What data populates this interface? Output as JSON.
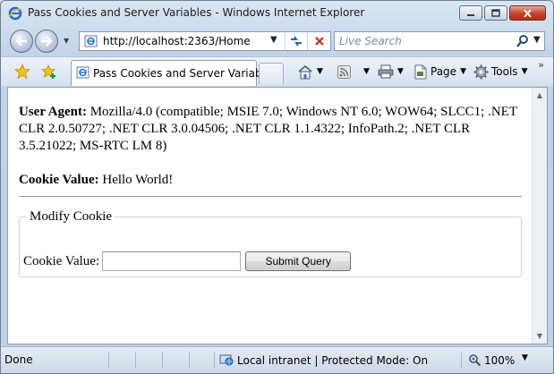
{
  "window": {
    "title": "Pass Cookies and Server Variables - Windows Internet Explorer"
  },
  "toolbar": {
    "address": "http://localhost:2363/Home",
    "search_placeholder": "Live Search"
  },
  "tab": {
    "label": "Pass Cookies and Server Variables"
  },
  "commands": {
    "page_label": "Page",
    "tools_label": "Tools",
    "more": "»"
  },
  "content": {
    "user_agent_label": "User Agent:",
    "user_agent_value": " Mozilla/4.0 (compatible; MSIE 7.0; Windows NT 6.0; WOW64; SLCC1; .NET CLR 2.0.50727; .NET CLR 3.0.04506; .NET CLR 1.1.4322; InfoPath.2; .NET CLR 3.5.21022; MS-RTC LM 8)",
    "cookie_label": "Cookie Value:",
    "cookie_value": " Hello World!",
    "fieldset_legend": "Modify Cookie",
    "input_label": "Cookie Value:",
    "input_value": "",
    "submit_label": "Submit Query"
  },
  "status": {
    "text": "Done",
    "zone": "Local intranet | Protected Mode: On",
    "zoom": "100%"
  },
  "colors": {
    "chrome": "#c3d4e8",
    "close_button": "#c3452b",
    "link_blue": "#1f5fbf"
  },
  "icons": [
    "ie-logo-icon",
    "back-arrow-icon",
    "forward-arrow-icon",
    "page-favicon-icon",
    "refresh-icon",
    "stop-icon",
    "search-icon",
    "favorites-star-icon",
    "add-favorites-icon",
    "home-icon",
    "feeds-icon",
    "print-icon",
    "page-icon",
    "tools-gear-icon",
    "intranet-globe-icon",
    "zoom-magnifier-icon"
  ]
}
